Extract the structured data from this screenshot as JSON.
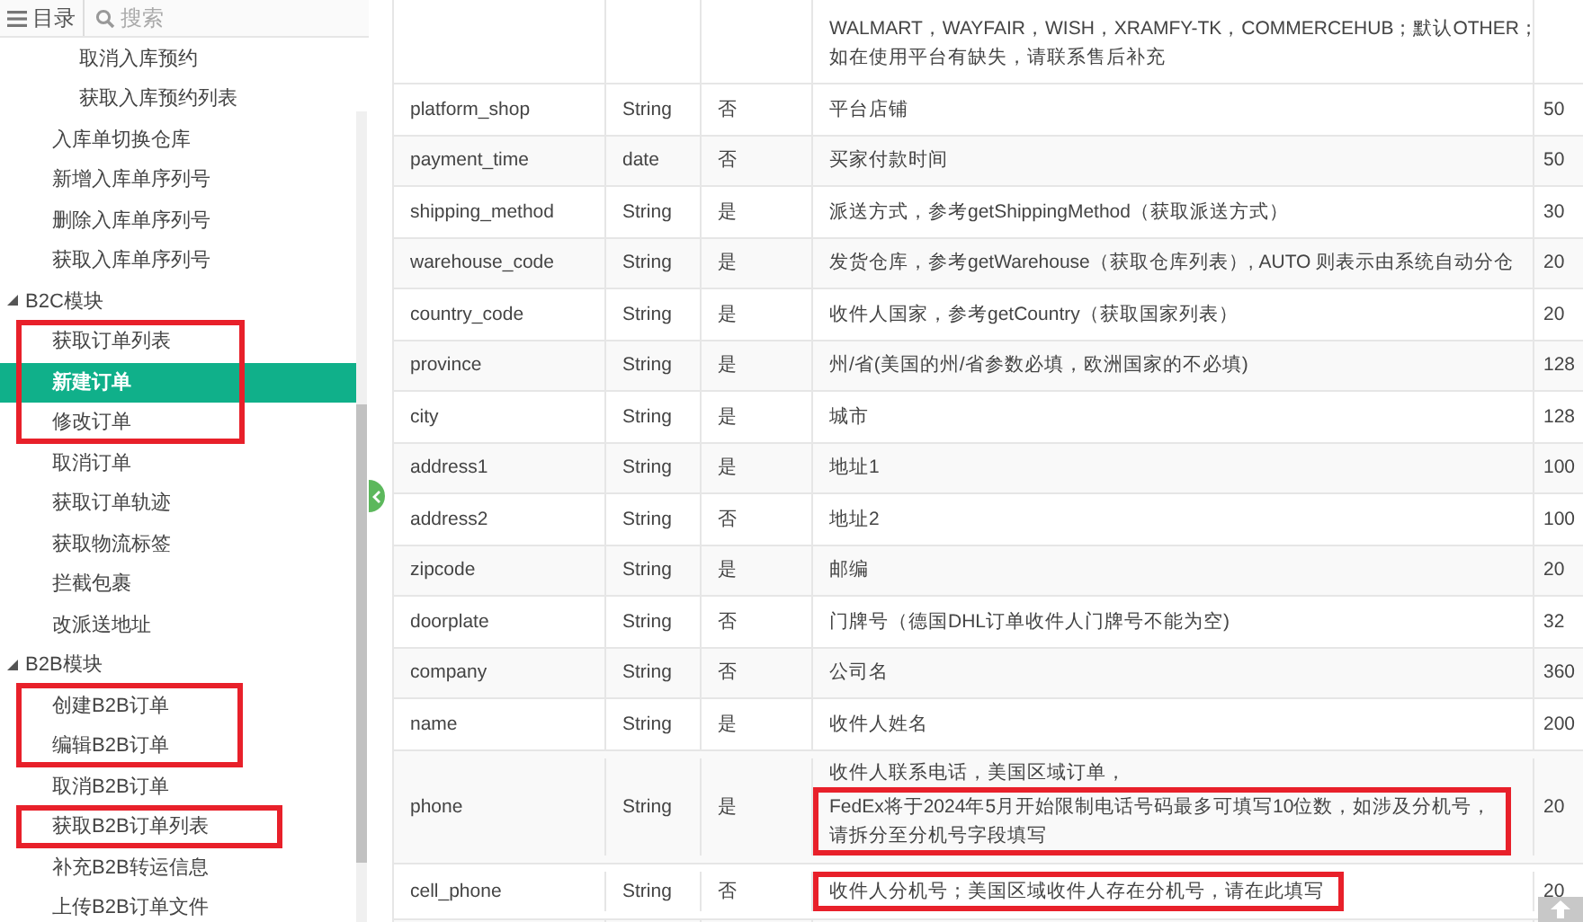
{
  "sidebar": {
    "tab_label": "目录",
    "search_placeholder": "搜索",
    "tree": [
      {
        "children": [
          {
            "children": [
              {
                "label": "取消入库预约",
                "selected": false,
                "marked": false
              },
              {
                "label": "获取入库预约列表",
                "selected": false,
                "marked": false
              }
            ]
          },
          {
            "label": "入库单切换仓库",
            "selected": false,
            "marked": false
          },
          {
            "label": "新增入库单序列号",
            "selected": false,
            "marked": false
          },
          {
            "label": "删除入库单序列号",
            "selected": false,
            "marked": false
          },
          {
            "label": "获取入库单序列号",
            "selected": false,
            "marked": false
          }
        ]
      },
      {
        "label": "B2C模块",
        "expanded": true,
        "selected": false,
        "marked": false,
        "children": [
          {
            "label": "获取订单列表",
            "selected": false,
            "marked": true
          },
          {
            "label": "新建订单",
            "selected": true,
            "marked": true
          },
          {
            "label": "修改订单",
            "selected": false,
            "marked": true
          },
          {
            "label": "取消订单",
            "selected": false,
            "marked": false
          },
          {
            "label": "获取订单轨迹",
            "selected": false,
            "marked": false
          },
          {
            "label": "获取物流标签",
            "selected": false,
            "marked": false
          },
          {
            "label": "拦截包裹",
            "selected": false,
            "marked": false
          },
          {
            "label": "改派送地址",
            "selected": false,
            "marked": false
          }
        ]
      },
      {
        "label": "B2B模块",
        "expanded": true,
        "selected": false,
        "marked": false,
        "children": [
          {
            "label": "创建B2B订单",
            "selected": false,
            "marked": true
          },
          {
            "label": "编辑B2B订单",
            "selected": false,
            "marked": true
          },
          {
            "label": "取消B2B订单",
            "selected": false,
            "marked": false
          },
          {
            "label": "获取B2B订单列表",
            "selected": false,
            "marked": true
          },
          {
            "label": "补充B2B转运信息",
            "selected": false,
            "marked": false
          },
          {
            "label": "上传B2B订单文件",
            "selected": false,
            "marked": false
          }
        ]
      }
    ]
  },
  "table": {
    "rows": [
      {
        "description": [
          {
            "text": "WALMART，WAYFAIR，WISH，XRAMFY-TK，COMMERCEHUB；默认OTHER；",
            "marked": false
          },
          {
            "text": "如在使用平台有缺失，请联系售后补充",
            "marked": false
          }
        ]
      },
      {
        "field": "platform_shop",
        "type": "String",
        "required": "否",
        "description": [
          {
            "text": "平台店铺",
            "marked": false
          }
        ],
        "length": "50"
      },
      {
        "field": "payment_time",
        "type": "date",
        "required": "否",
        "description": [
          {
            "text": "买家付款时间",
            "marked": false
          }
        ],
        "length": "50"
      },
      {
        "field": "shipping_method",
        "type": "String",
        "required": "是",
        "description": [
          {
            "text": "派送方式，参考getShippingMethod（获取派送方式）",
            "marked": false
          }
        ],
        "length": "30"
      },
      {
        "field": "warehouse_code",
        "type": "String",
        "required": "是",
        "description": [
          {
            "text": "发货仓库，参考getWarehouse（获取仓库列表）, AUTO 则表示由系统自动分仓",
            "marked": false
          }
        ],
        "length": "20"
      },
      {
        "field": "country_code",
        "type": "String",
        "required": "是",
        "description": [
          {
            "text": "收件人国家，参考getCountry（获取国家列表）",
            "marked": false
          }
        ],
        "length": "20"
      },
      {
        "field": "province",
        "type": "String",
        "required": "是",
        "description": [
          {
            "text": "州/省(美国的州/省参数必填，欧洲国家的不必填)",
            "marked": false
          }
        ],
        "length": "128"
      },
      {
        "field": "city",
        "type": "String",
        "required": "是",
        "description": [
          {
            "text": "城市",
            "marked": false
          }
        ],
        "length": "128"
      },
      {
        "field": "address1",
        "type": "String",
        "required": "是",
        "description": [
          {
            "text": "地址1",
            "marked": false
          }
        ],
        "length": "100"
      },
      {
        "field": "address2",
        "type": "String",
        "required": "否",
        "description": [
          {
            "text": "地址2",
            "marked": false
          }
        ],
        "length": "100"
      },
      {
        "field": "zipcode",
        "type": "String",
        "required": "是",
        "description": [
          {
            "text": "邮编",
            "marked": false
          }
        ],
        "length": "20"
      },
      {
        "field": "doorplate",
        "type": "String",
        "required": "否",
        "description": [
          {
            "text": "门牌号（德国DHL订单收件人门牌号不能为空)",
            "marked": false
          }
        ],
        "length": "32"
      },
      {
        "field": "company",
        "type": "String",
        "required": "否",
        "description": [
          {
            "text": "公司名",
            "marked": false
          }
        ],
        "length": "360"
      },
      {
        "field": "name",
        "type": "String",
        "required": "是",
        "description": [
          {
            "text": "收件人姓名",
            "marked": false
          }
        ],
        "length": "200"
      },
      {
        "field": "phone",
        "type": "String",
        "required": "是",
        "description": [
          {
            "text": "收件人联系电话，美国区域订单，",
            "marked": false
          },
          {
            "text": "FedEx将于2024年5月开始限制电话号码最多可填写10位数，如涉及分机号，",
            "marked": true
          },
          {
            "text": "请拆分至分机号字段填写",
            "marked": true
          }
        ],
        "length": "20"
      },
      {
        "field": "cell_phone",
        "type": "String",
        "required": "否",
        "description": [
          {
            "text": "收件人分机号；美国区域收件人存在分机号，请在此填写",
            "marked": true
          }
        ],
        "length": "20"
      },
      {
        "description": []
      }
    ]
  }
}
